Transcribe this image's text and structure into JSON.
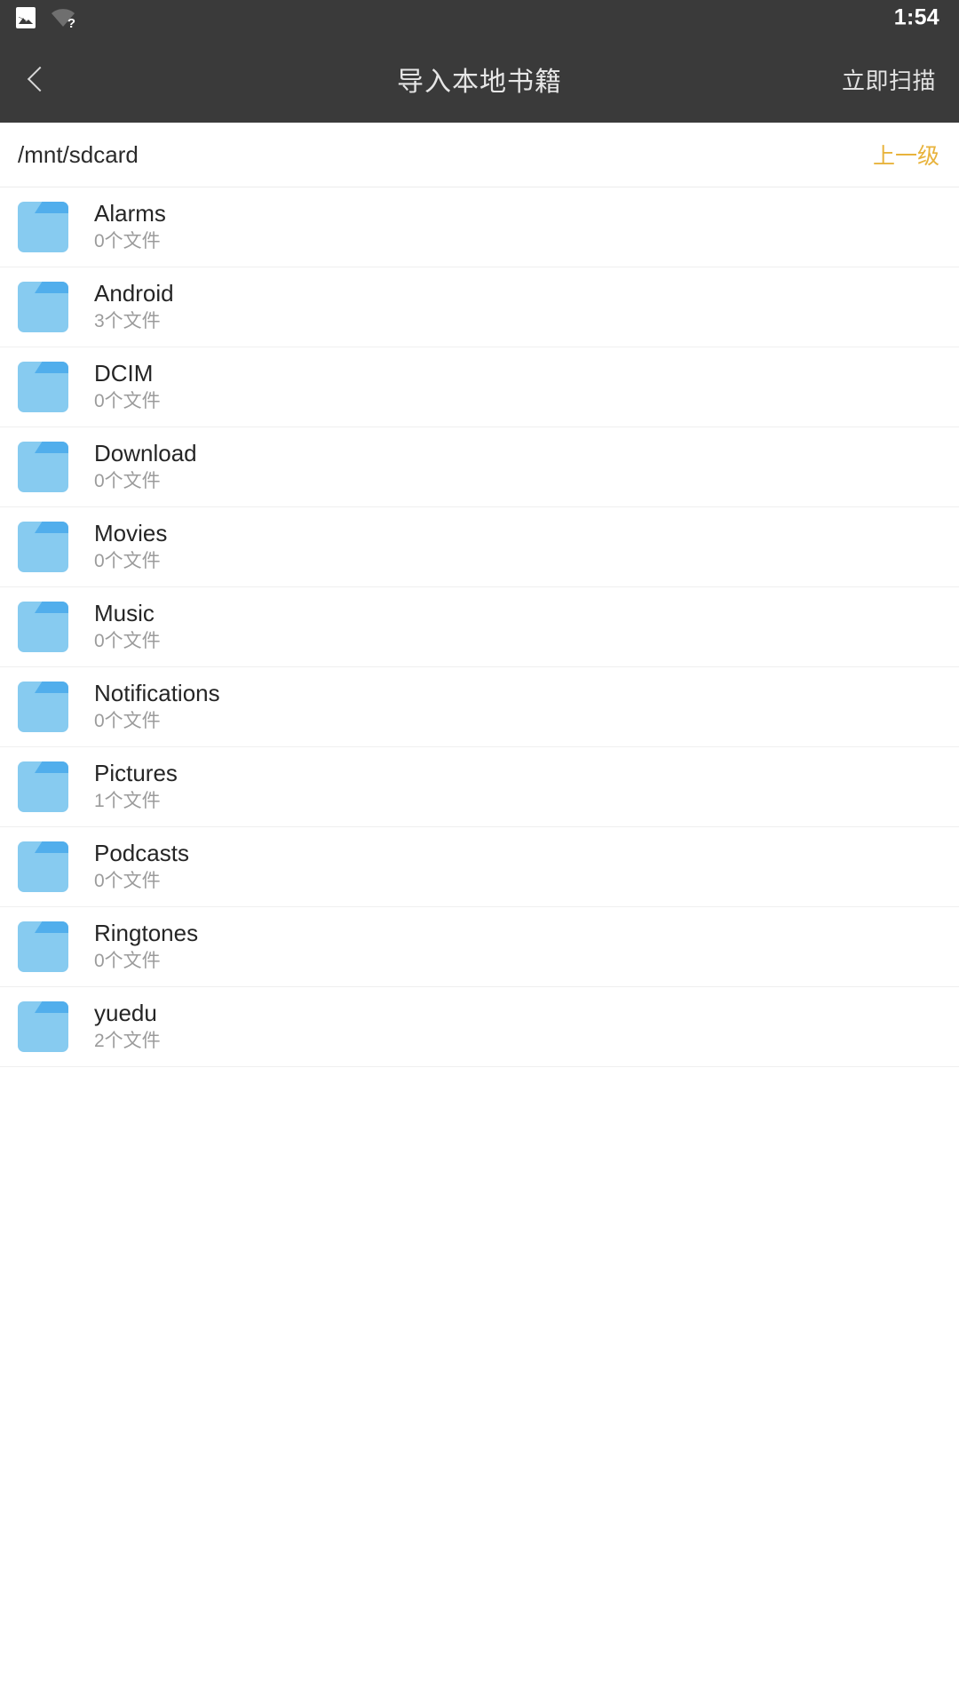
{
  "status_bar": {
    "icons": [
      {
        "name": "image-icon",
        "glyph": "picture"
      },
      {
        "name": "wifi-question-icon",
        "glyph": "wifi-unknown",
        "badge": "?"
      }
    ],
    "time": "1:54",
    "background_color": "#3a3a3a"
  },
  "app_bar": {
    "back_icon": "chevron-left-icon",
    "title": "导入本地书籍",
    "action_label": "立即扫描",
    "background_color": "#3a3a3a",
    "title_color": "#e6e6e6"
  },
  "path_bar": {
    "path": "/mnt/sdcard",
    "up_label": "上一级",
    "up_color": "#e8b33c"
  },
  "file_list": {
    "icon_name": "folder-icon",
    "icon_color": "#87cbf0",
    "icon_tab_color": "#51aeec",
    "items": [
      {
        "name": "Alarms",
        "count": "0个文件"
      },
      {
        "name": "Android",
        "count": "3个文件"
      },
      {
        "name": "DCIM",
        "count": "0个文件"
      },
      {
        "name": "Download",
        "count": "0个文件"
      },
      {
        "name": "Movies",
        "count": "0个文件"
      },
      {
        "name": "Music",
        "count": "0个文件"
      },
      {
        "name": "Notifications",
        "count": "0个文件"
      },
      {
        "name": "Pictures",
        "count": "1个文件"
      },
      {
        "name": "Podcasts",
        "count": "0个文件"
      },
      {
        "name": "Ringtones",
        "count": "0个文件"
      },
      {
        "name": "yuedu",
        "count": "2个文件"
      }
    ]
  }
}
